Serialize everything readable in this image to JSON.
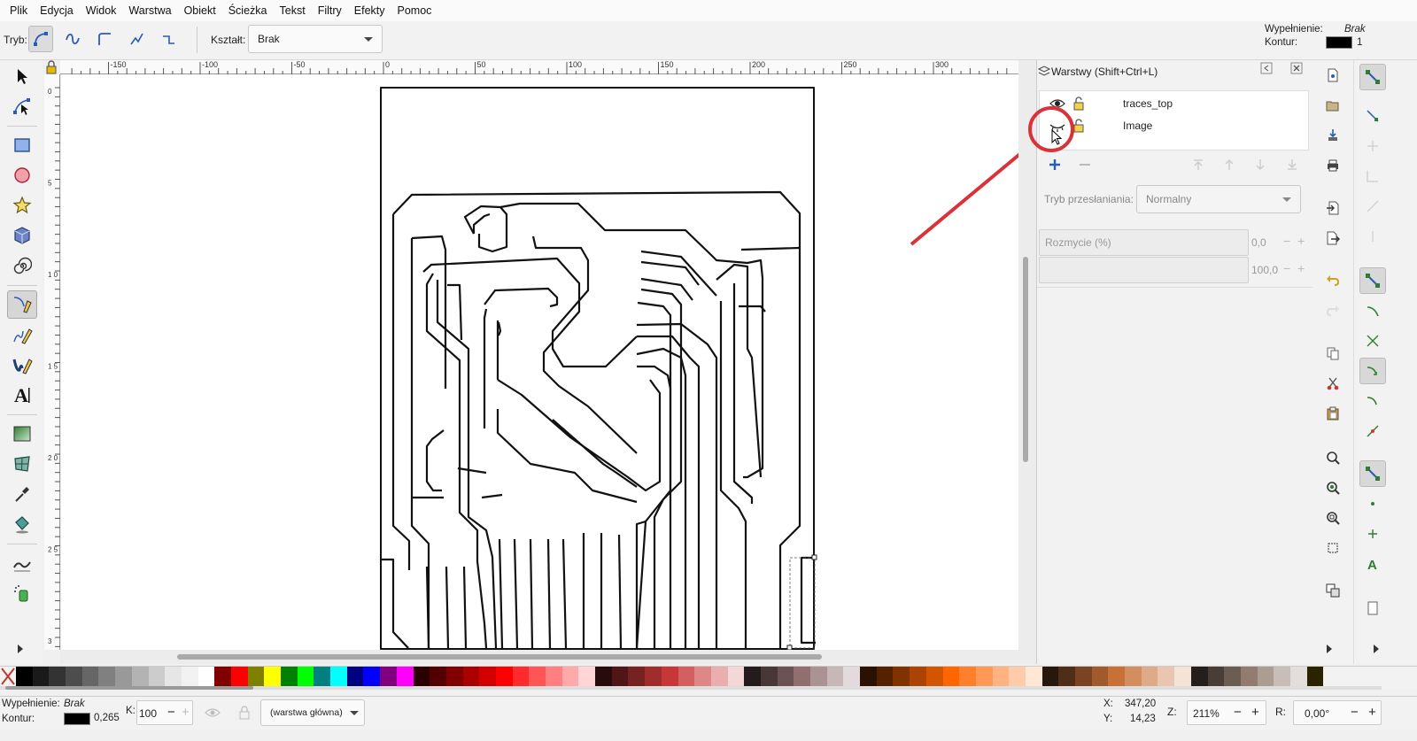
{
  "menu": [
    "Plik",
    "Edycja",
    "Widok",
    "Warstwa",
    "Obiekt",
    "Ścieżka",
    "Tekst",
    "Filtry",
    "Efekty",
    "Pomoc"
  ],
  "toolbar": {
    "mode_label": "Tryb:",
    "shape_label": "Kształt:",
    "shape_value": "Brak",
    "fill_label": "Wypełnienie:",
    "fill_value": "Brak",
    "stroke_label": "Kontur:",
    "stroke_width": "1"
  },
  "ruler": {
    "h_ticks": [
      "-150",
      "-100",
      "-50",
      "0",
      "50",
      "100",
      "150",
      "200",
      "250",
      "300"
    ],
    "v_ticks": [
      "0",
      "5",
      "1 0",
      "1 5",
      "2 0",
      "2 5",
      "3"
    ]
  },
  "layers_panel": {
    "title": "Warstwy (Shift+Ctrl+L)",
    "layers": [
      {
        "name": "traces_top",
        "visible": true,
        "locked": false
      },
      {
        "name": "Image",
        "visible": false,
        "locked": false
      }
    ],
    "blend_label": "Tryb przesłaniania:",
    "blend_value": "Normalny",
    "blur_label": "Rozmycie (%)",
    "blur_value": "0,0",
    "opacity_label": "Krycie (%)",
    "opacity_value": "100,0"
  },
  "palette": [
    "#000000",
    "#1a1a1a",
    "#333333",
    "#4d4d4d",
    "#666666",
    "#808080",
    "#999999",
    "#b3b3b3",
    "#cccccc",
    "#e6e6e6",
    "#f2f2f2",
    "#ffffff",
    "#800000",
    "#ff0000",
    "#808000",
    "#ffff00",
    "#008000",
    "#00ff00",
    "#008080",
    "#00ffff",
    "#000080",
    "#0000ff",
    "#800080",
    "#ff00ff",
    "#2b0000",
    "#550000",
    "#800000",
    "#aa0000",
    "#d40000",
    "#ff0000",
    "#ff2a2a",
    "#ff5555",
    "#ff8080",
    "#ffaaaa",
    "#ffd5d5",
    "#280b0b",
    "#501616",
    "#782121",
    "#a02c2c",
    "#c83737",
    "#d35f5f",
    "#de8787",
    "#e9afaf",
    "#f4d7d7",
    "#241c1c",
    "#483737",
    "#6c5353",
    "#916f6f",
    "#ac9393",
    "#c8b7b7",
    "#e3dbdb",
    "#2b1100",
    "#552200",
    "#803300",
    "#aa4400",
    "#d45500",
    "#ff6600",
    "#ff7f2a",
    "#ff9955",
    "#ffb380",
    "#ffccaa",
    "#ffe6d5",
    "#28170b",
    "#502d16",
    "#784421",
    "#a05a2c",
    "#c87137",
    "#d38d5f",
    "#deaa87",
    "#e9c6af",
    "#f4e3d7",
    "#241f1c",
    "#483e37",
    "#6c5d53",
    "#917c6f",
    "#ac9d93",
    "#c8beb7",
    "#e3dedb",
    "#2b2200"
  ],
  "status": {
    "fill_label": "Wypełnienie:",
    "fill_value": "Brak",
    "stroke_label": "Kontur:",
    "stroke_width": "0,265",
    "opacity_label": "K:",
    "opacity_value": "100",
    "layer_value": "(warstwa główna)",
    "x_label": "X:",
    "x_value": "347,20",
    "y_label": "Y:",
    "y_value": "14,23",
    "zoom_label": "Z:",
    "zoom_value": "211%",
    "rotate_label": "R:",
    "rotate_value": "0,00°"
  },
  "colors": {
    "accent": "#2a5bb5",
    "annotation": "#d9333a"
  }
}
